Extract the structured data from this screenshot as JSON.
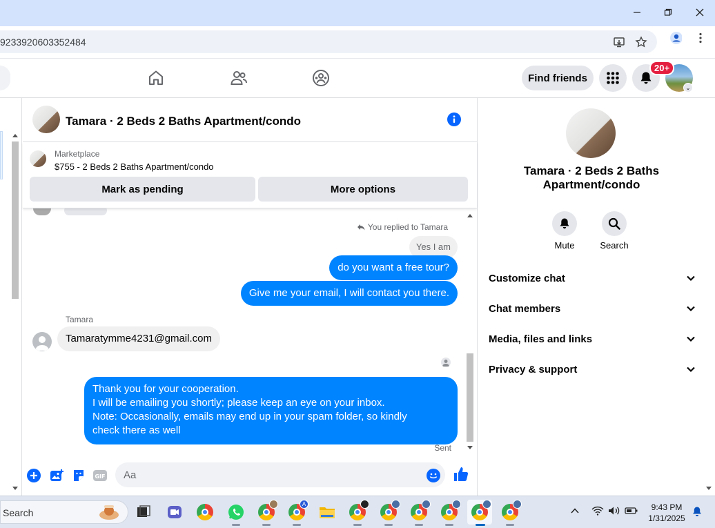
{
  "browser": {
    "url": "9233920603352484"
  },
  "fb_nav": {
    "find_friends": "Find friends",
    "notif_count": "20+"
  },
  "chat": {
    "title": "Tamara · 2 Beds 2 Baths Apartment/condo",
    "marketplace_label": "Marketplace",
    "listing": "$755 - 2 Beds 2 Baths Apartment/condo",
    "mark_pending": "Mark as pending",
    "more_options": "More options",
    "replied_note": "You replied to Tamara",
    "messages": [
      {
        "dir": "in",
        "text": "Yes I am"
      },
      {
        "dir": "out",
        "text": "do you want a free tour?"
      },
      {
        "dir": "out",
        "text": "Give me your email, I will contact you there."
      },
      {
        "dir": "in",
        "sender": "Tamara",
        "text": "Tamaratymme4231@gmail.com"
      },
      {
        "dir": "out",
        "lines": [
          "Thank you for your cooperation.",
          "I will be emailing you shortly; please keep an eye on your inbox.",
          "Note: Occasionally, emails may end up in your spam folder, so kindly",
          "check there as well"
        ]
      }
    ],
    "status": "Sent",
    "composer_placeholder": "Aa"
  },
  "panel": {
    "name": "Tamara · 2 Beds 2 Baths Apartment/condo",
    "mute": "Mute",
    "search": "Search",
    "sections": [
      "Customize chat",
      "Chat members",
      "Media, files and links",
      "Privacy & support"
    ]
  },
  "taskbar": {
    "search": "Search",
    "time": "9:43 PM",
    "date": "1/31/2025"
  },
  "colors": {
    "messenger_blue": "#0084ff",
    "fb_blue": "#0866ff",
    "badge_red": "#e41e3f"
  }
}
